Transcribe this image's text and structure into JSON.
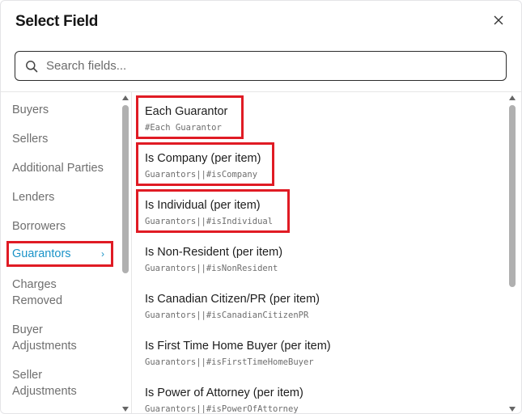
{
  "dialog": {
    "title": "Select Field",
    "close_icon": "close-icon"
  },
  "search": {
    "placeholder": "Search fields...",
    "value": "",
    "icon": "search-icon"
  },
  "categories": [
    {
      "label": "Buyers",
      "active": false
    },
    {
      "label": "Sellers",
      "active": false
    },
    {
      "label": "Additional Parties",
      "active": false
    },
    {
      "label": "Lenders",
      "active": false
    },
    {
      "label": "Borrowers",
      "active": false
    },
    {
      "label": "Guarantors",
      "active": true,
      "chevron": "›"
    },
    {
      "label": "Charges\nRemoved",
      "active": false
    },
    {
      "label": "Buyer\nAdjustments",
      "active": false
    },
    {
      "label": "Seller\nAdjustments",
      "active": false
    }
  ],
  "fields": [
    {
      "label": "Each Guarantor",
      "path": "#Each Guarantor",
      "highlighted": true
    },
    {
      "label": "Is Company (per item)",
      "path": "Guarantors||#isCompany",
      "highlighted": true
    },
    {
      "label": "Is Individual (per item)",
      "path": "Guarantors||#isIndividual",
      "highlighted": true
    },
    {
      "label": "Is Non-Resident (per item)",
      "path": "Guarantors||#isNonResident",
      "highlighted": false
    },
    {
      "label": "Is Canadian Citizen/PR (per item)",
      "path": "Guarantors||#isCanadianCitizenPR",
      "highlighted": false
    },
    {
      "label": "Is First Time Home Buyer (per item)",
      "path": "Guarantors||#isFirstTimeHomeBuyer",
      "highlighted": false
    },
    {
      "label": "Is Power of Attorney (per item)",
      "path": "Guarantors||#isPowerOfAttorney",
      "highlighted": false
    }
  ],
  "colors": {
    "accent": "#1a93c8",
    "highlight": "#e01b24",
    "muted": "#6f6f6f"
  }
}
